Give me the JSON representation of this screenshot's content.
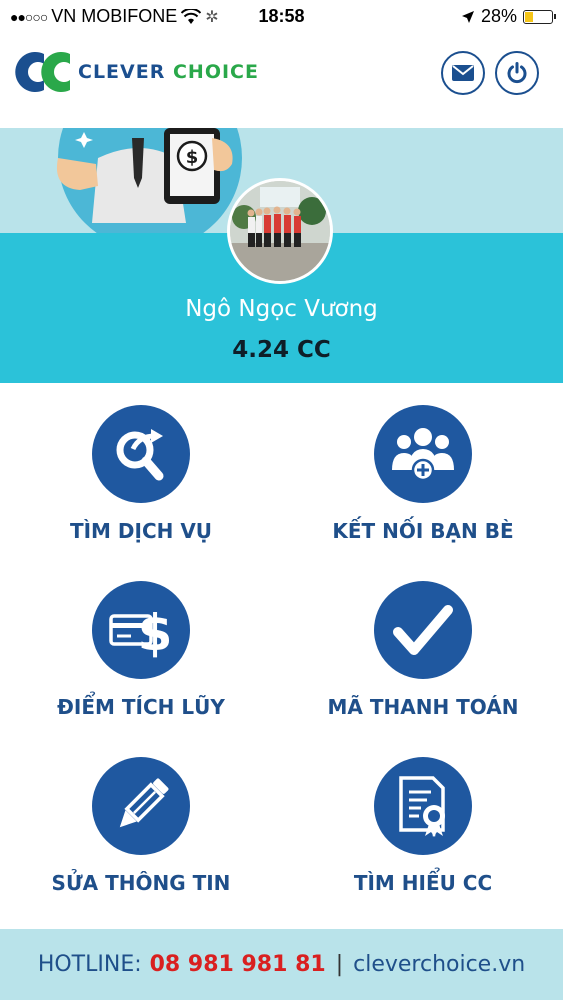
{
  "status_bar": {
    "carrier": "VN MOBIFONE",
    "time": "18:58",
    "battery": "28%",
    "battery_level": 0.28
  },
  "header": {
    "brand_part1": "CLEVER",
    "brand_part2": "CHOICE",
    "logo_icon": "cc-logo-icon",
    "mail_icon": "mail-icon",
    "power_icon": "power-icon"
  },
  "profile": {
    "name": "Ngô Ngọc Vương",
    "balance": "4.24 CC"
  },
  "menu": [
    {
      "label": "TÌM DỊCH VỤ",
      "icon": "search-service-icon"
    },
    {
      "label": "KẾT NỐI BẠN BÈ",
      "icon": "friends-icon"
    },
    {
      "label": "ĐIỂM TÍCH LŨY",
      "icon": "card-dollar-icon"
    },
    {
      "label": "MÃ THANH TOÁN",
      "icon": "checkmark-icon"
    },
    {
      "label": "SỬA THÔNG TIN",
      "icon": "pencil-icon"
    },
    {
      "label": "TÌM HIỂU CC",
      "icon": "certificate-icon"
    }
  ],
  "footer": {
    "hotline_label": "HOTLINE:",
    "hotline_number": "08 981 981 81",
    "separator": "|",
    "website": "cleverchoice.vn"
  },
  "colors": {
    "primary_blue": "#1f58a0",
    "brand_green": "#2aa84a",
    "profile_bg": "#2bc2d9",
    "banner_bg": "#b9e3ea",
    "hotline_red": "#d92020"
  }
}
